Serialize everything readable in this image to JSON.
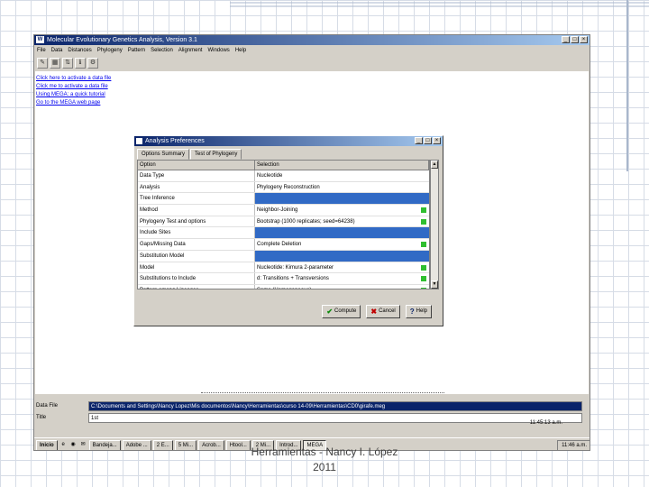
{
  "window": {
    "title": "Molecular Evolutionary Genetics Analysis, Version 3.1",
    "icon": "W"
  },
  "window_controls": [
    "_",
    "□",
    "×"
  ],
  "menu": [
    "File",
    "Data",
    "Distances",
    "Phylogeny",
    "Pattern",
    "Selection",
    "Alignment",
    "Windows",
    "Help"
  ],
  "toolbar_glyphs": [
    "✎",
    "▦",
    "⇅",
    "ℹ",
    "⚙"
  ],
  "links": [
    "Click here to activate a data file",
    "Click me to activate a data file",
    "Using MEGA: a quick tutorial",
    "Go to the MEGA web page"
  ],
  "dialog": {
    "title": "Analysis Preferences",
    "tabs": [
      "Options Summary",
      "Test of Phylogeny"
    ],
    "columns": [
      "Option",
      "Selection"
    ],
    "rows": [
      {
        "option": "Data Type",
        "selection": "Nucleotide",
        "highlight": false,
        "mark": false
      },
      {
        "option": "Analysis",
        "selection": "Phylogeny Reconstruction",
        "highlight": false,
        "mark": false
      },
      {
        "option": "Tree Inference",
        "selection": "",
        "highlight": true,
        "mark": false
      },
      {
        "option": "  Method",
        "selection": "Neighbor-Joining",
        "highlight": false,
        "mark": true
      },
      {
        "option": "  Phylogeny Test and options",
        "selection": "Bootstrap (1000 replicates; seed=64238)",
        "highlight": false,
        "mark": true
      },
      {
        "option": "Include Sites",
        "selection": "",
        "highlight": true,
        "mark": false
      },
      {
        "option": "  Gaps/Missing Data",
        "selection": "Complete Deletion",
        "highlight": false,
        "mark": true
      },
      {
        "option": "Substitution Model",
        "selection": "",
        "highlight": true,
        "mark": false
      },
      {
        "option": "  Model",
        "selection": "Nucleotide: Kimura 2-parameter",
        "highlight": false,
        "mark": true
      },
      {
        "option": "  Substitutions to Include",
        "selection": "d: Transitions + Transversions",
        "highlight": false,
        "mark": true
      },
      {
        "option": "  Pattern among Lineages",
        "selection": "Same (Homogeneous)",
        "highlight": false,
        "mark": true
      }
    ],
    "scroll_up": "▲",
    "scroll_down": "▼",
    "buttons": [
      {
        "name": "compute-button",
        "icon": "✔",
        "label": "Compute"
      },
      {
        "name": "cancel-button",
        "icon": "✖",
        "label": "Cancel"
      },
      {
        "name": "help-button",
        "icon": "?",
        "label": "Help"
      }
    ]
  },
  "status": {
    "data_file_label": "Data File",
    "data_file_value": "C:\\Documents and Settings\\Nancy Lopez\\Mis documentos\\Nancy\\Herramientas\\curso 14-09\\Herramientas\\CD0\\girafe.meg",
    "title_label": "Title",
    "title_value": "1st",
    "time": "11:45:13 a.m."
  },
  "taskbar": {
    "start": "Inicio",
    "quick": [
      "e",
      "◉",
      "✉"
    ],
    "tasks": [
      "Bandeja...",
      "Adobe ...",
      "2 E...",
      "5 Mi...",
      "Acrob...",
      "Htool...",
      "2 Mi...",
      "Introd...",
      "MEGA"
    ],
    "active_task": 8,
    "tray": "11:46 a.m."
  },
  "caption": {
    "line1": "Herramientas - Nancy I. López",
    "line2": "2011"
  },
  "colors": {
    "titlebar": "#0a246a",
    "selection": "#316ac5",
    "mark": "#2fbf2f",
    "face": "#d4d0c8"
  }
}
